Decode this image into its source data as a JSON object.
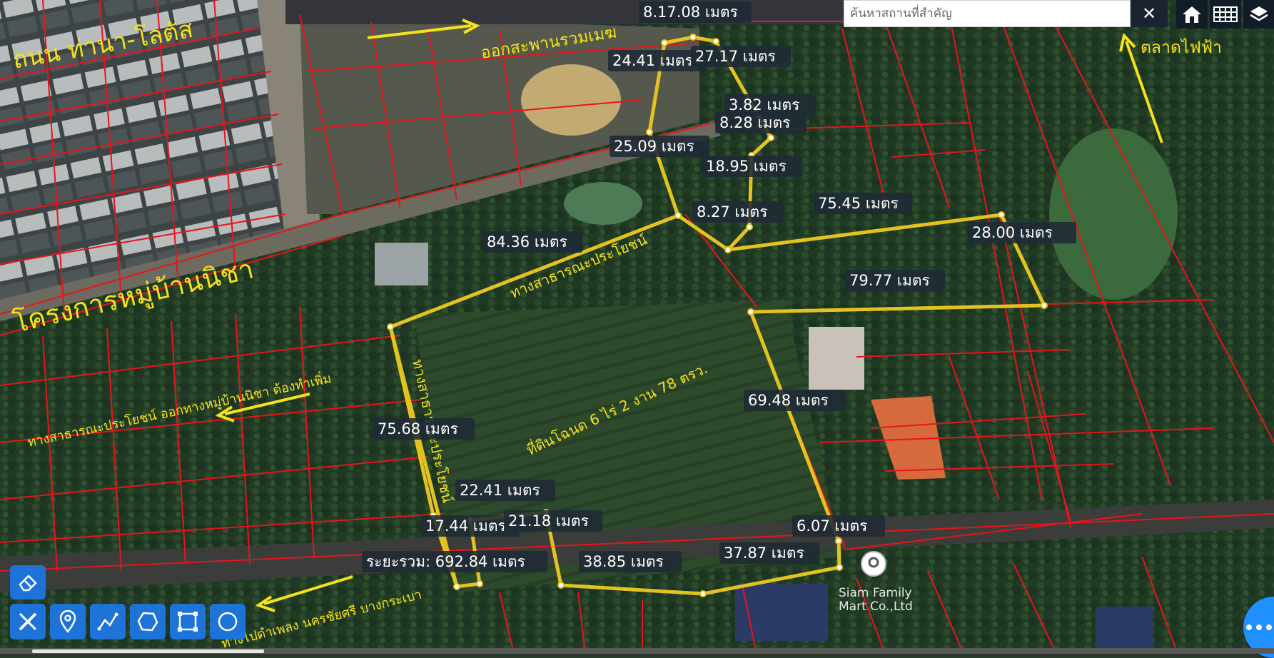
{
  "search": {
    "placeholder": "ค้นหาสถานที่สำคัญ"
  },
  "toolbar": {
    "close_glyph": "✕",
    "icons": [
      "home-icon",
      "table-grid-icon",
      "layers-icon"
    ]
  },
  "draw_tools": [
    "eraser-icon",
    "ruler-icon",
    "location-pin-icon",
    "polyline-icon",
    "polygon-icon",
    "rectangle-icon",
    "circle-icon"
  ],
  "fab": {
    "icon": "more-dots-icon"
  },
  "place_marker": {
    "name": "Siam Family Mart Co.,Ltd"
  },
  "annotations": {
    "road_thana_lotus": "ถนน ท่านา-โลตัส",
    "exit_bridge": "ออกสะพานรวมเมฆ",
    "electric_market": "ตลาดไฟฟ้า",
    "village_project": "โครงการหมู่บ้านนิชา",
    "public_way_north": "ทางสาธารณะประโยชน์",
    "public_way_west_exit": "ทางสาธารณะประโยชน์ ออกทางหมู่บ้านนิชา ต้องทำเพิ่ม",
    "public_way_vertical": "ทางสาธารณะประโยชน์",
    "land_title": "ที่ดินโฉนด 6 ไร่ 2 งาน 78 ตรว.",
    "to_damphleng": "ทางไปดำเพลง นครชัยศรี บางกระเบา"
  },
  "measurements": {
    "top_overlap": "8.17.08 เมตร",
    "m24_41": "24.41 เมตร",
    "m27_17": "27.17 เมตร",
    "m3_82": "3.82 เมตร",
    "m8_28": "8.28 เมตร",
    "m25_09": "25.09 เมตร",
    "m18_95": "18.95 เมตร",
    "m75_45": "75.45 เมตร",
    "m8_27": "8.27 เมตร",
    "m84_36": "84.36 เมตร",
    "m28_00": "28.00 เมตร",
    "m79_77": "79.77 เมตร",
    "m69_48": "69.48 เมตร",
    "m75_68": "75.68 เมตร",
    "m22_41": "22.41 เมตร",
    "m17_44": "17.44 เมตร",
    "m21_18": "21.18 เมตร",
    "m6_07": "6.07 เมตร",
    "m37_87": "37.87 เมตร",
    "m38_85": "38.85 เมตร",
    "total_overlap": "ระยะรวม: 692.84 เมตร"
  },
  "colors": {
    "parcel_line": "#e8141b",
    "boundary": "#e4c21f",
    "annotation_text": "#f4e21a",
    "label_bg": "#1f2a36",
    "tool_blue": "#1e73d8",
    "fab_blue": "#1e90ff"
  }
}
